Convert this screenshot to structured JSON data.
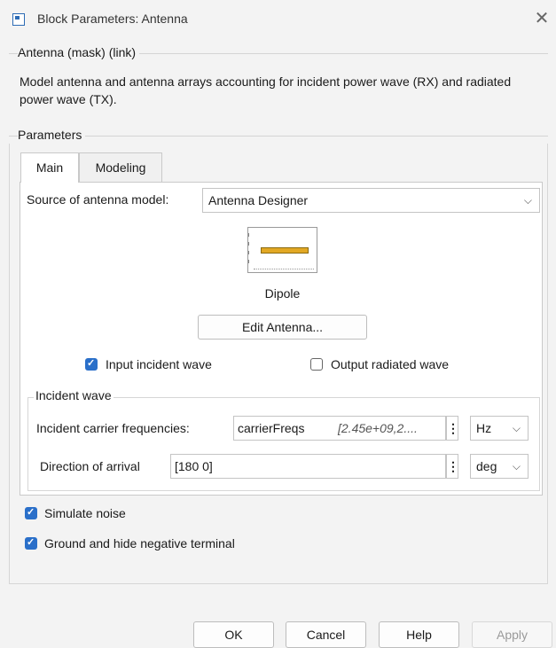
{
  "window": {
    "title": "Block Parameters: Antenna",
    "close_icon": "close-icon"
  },
  "block": {
    "header": "Antenna (mask) (link)",
    "description": "Model antenna and antenna arrays accounting for incident power wave (RX) and radiated power wave (TX)."
  },
  "parameters": {
    "header": "Parameters",
    "tabs": [
      {
        "label": "Main",
        "active": true
      },
      {
        "label": "Modeling",
        "active": false
      }
    ]
  },
  "main": {
    "source_label": "Source of antenna model:",
    "source_value": "Antenna Designer",
    "antenna_name": "Dipole",
    "edit_button": "Edit Antenna...",
    "input_incident_wave": {
      "label": "Input incident wave",
      "checked": true
    },
    "output_radiated_wave": {
      "label": "Output radiated wave",
      "checked": false
    }
  },
  "incident": {
    "header": "Incident wave",
    "freq_label": "Incident carrier frequencies:",
    "freq_value": "carrierFreqs",
    "freq_preview": "[2.45e+09,2....",
    "freq_unit": "Hz",
    "doa_label": "Direction of arrival",
    "doa_value": "[180 0]",
    "doa_unit": "deg"
  },
  "options": {
    "simulate_noise": {
      "label": "Simulate noise",
      "checked": true
    },
    "ground_negative": {
      "label": "Ground and hide negative terminal",
      "checked": true
    }
  },
  "buttons": {
    "ok": "OK",
    "cancel": "Cancel",
    "help": "Help",
    "apply": "Apply"
  },
  "colors": {
    "accent": "#2a6fc9",
    "dipole": "#e2a824",
    "disabled_text": "#9a9a9a"
  }
}
